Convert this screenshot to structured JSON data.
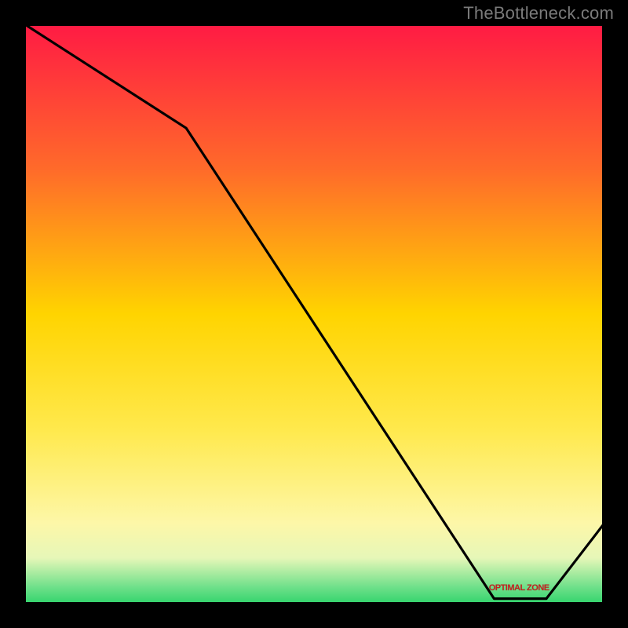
{
  "watermark": "TheBottleneck.com",
  "annotation_label": "OPTIMAL ZONE",
  "chart_data": {
    "type": "line",
    "title": "",
    "xlabel": "",
    "ylabel": "",
    "xlim": [
      0,
      100
    ],
    "ylim": [
      0,
      100
    ],
    "x": [
      0,
      28,
      81,
      90,
      100
    ],
    "values": [
      100,
      82,
      1,
      1,
      14
    ],
    "gradient_stops": [
      {
        "offset": 0,
        "color": "#ff1a44"
      },
      {
        "offset": 0.25,
        "color": "#ff6a2a"
      },
      {
        "offset": 0.5,
        "color": "#ffd400"
      },
      {
        "offset": 0.7,
        "color": "#ffe94d"
      },
      {
        "offset": 0.86,
        "color": "#fdf7a8"
      },
      {
        "offset": 0.92,
        "color": "#e6f7b8"
      },
      {
        "offset": 0.97,
        "color": "#6fe08a"
      },
      {
        "offset": 1.0,
        "color": "#2fd36b"
      }
    ],
    "annotation_x": 85.5,
    "annotation_y": 2
  }
}
